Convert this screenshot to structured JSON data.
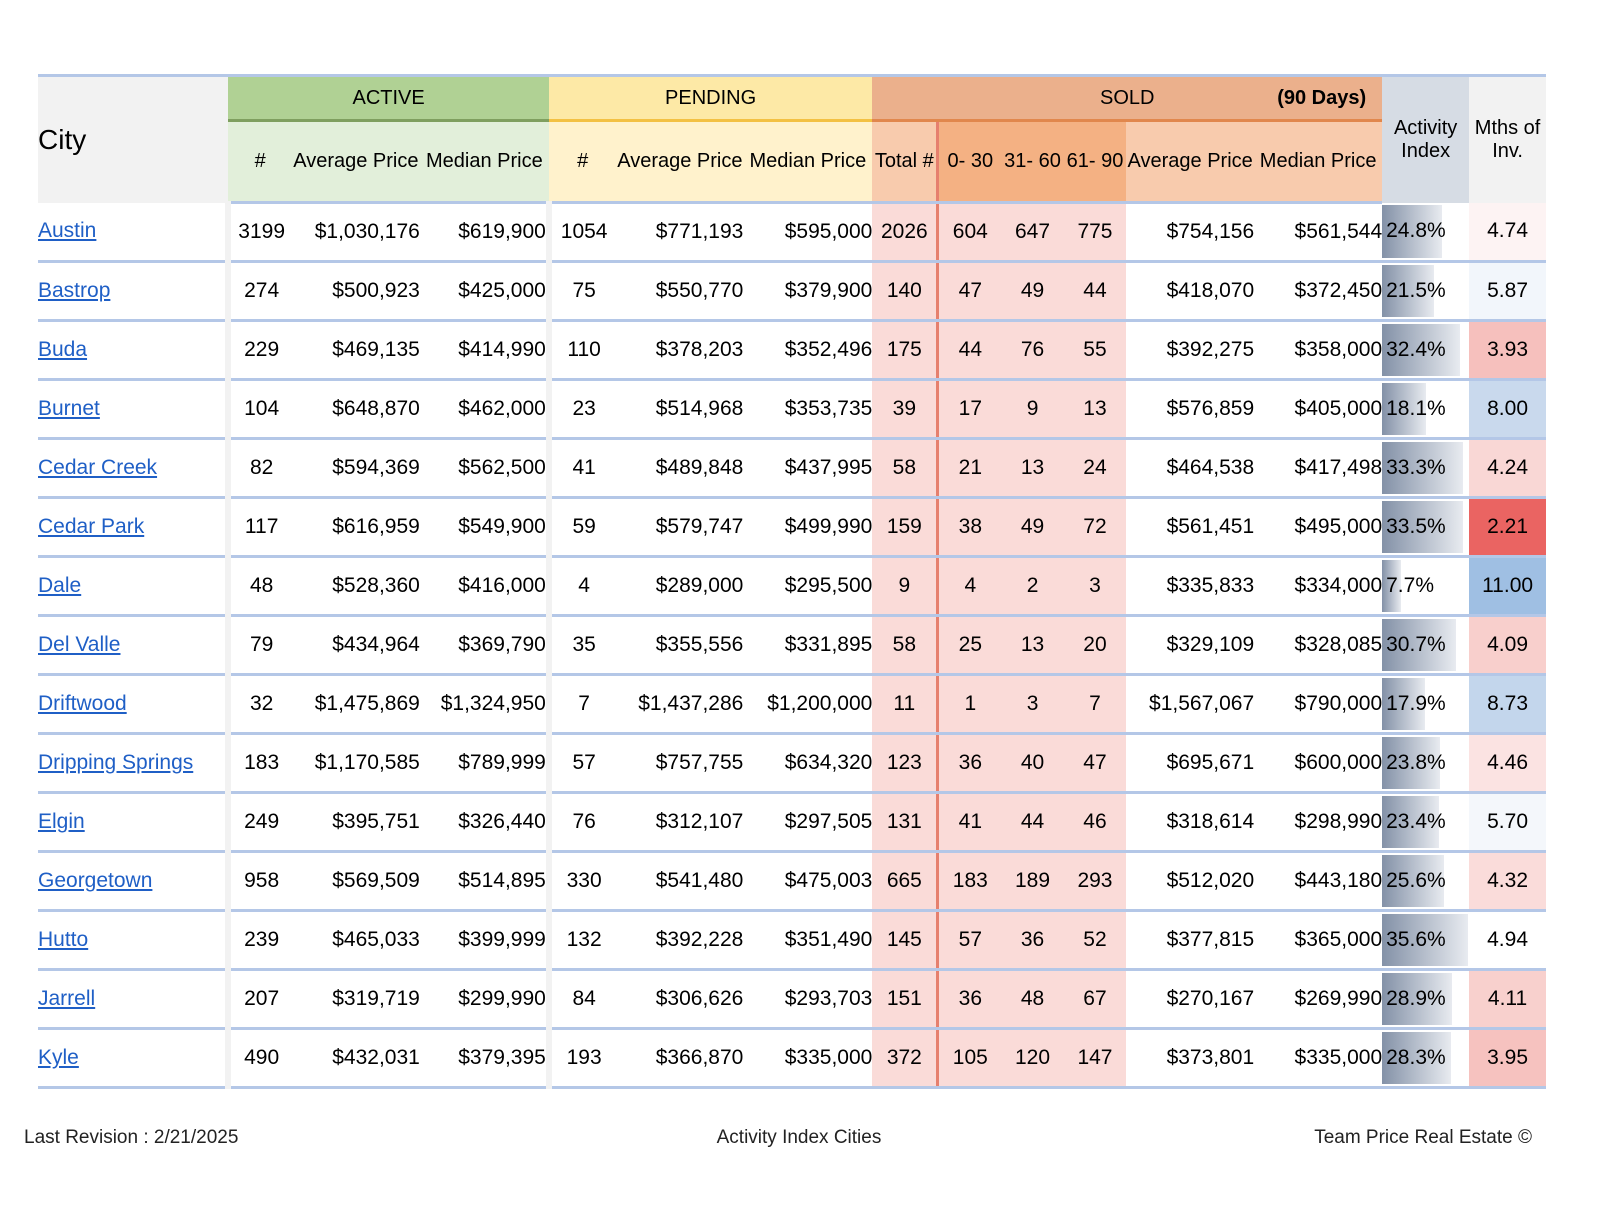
{
  "header": {
    "city": "City",
    "active": "ACTIVE",
    "pending": "PENDING",
    "sold": "SOLD",
    "sold_note": "(90 Days)",
    "activity_index": "Activity Index",
    "mths_of_inv": "Mths of Inv.",
    "count": "#",
    "avg_price": "Average Price",
    "median_price": "Median Price",
    "total": "Total #",
    "d0_30": "0- 30",
    "d31_60": "31- 60",
    "d61_90": "61- 90"
  },
  "rows": [
    {
      "city": "Austin",
      "a_n": "3199",
      "a_avg": "$1,030,176",
      "a_med": "$619,900",
      "p_n": "1054",
      "p_avg": "$771,193",
      "p_med": "$595,000",
      "s_tot": "2026",
      "s_30": "604",
      "s_60": "647",
      "s_90": "775",
      "s_avg": "$754,156",
      "s_med": "$561,544",
      "ai": "24.8%",
      "ai_level": 0.248,
      "mths": "4.74",
      "mths_color": "#fdf3f3"
    },
    {
      "city": "Bastrop",
      "a_n": "274",
      "a_avg": "$500,923",
      "a_med": "$425,000",
      "p_n": "75",
      "p_avg": "$550,770",
      "p_med": "$379,900",
      "s_tot": "140",
      "s_30": "47",
      "s_60": "49",
      "s_90": "44",
      "s_avg": "$418,070",
      "s_med": "$372,450",
      "ai": "21.5%",
      "ai_level": 0.215,
      "mths": "5.87",
      "mths_color": "#f2f6fb"
    },
    {
      "city": "Buda",
      "a_n": "229",
      "a_avg": "$469,135",
      "a_med": "$414,990",
      "p_n": "110",
      "p_avg": "$378,203",
      "p_med": "$352,496",
      "s_tot": "175",
      "s_30": "44",
      "s_60": "76",
      "s_90": "55",
      "s_avg": "$392,275",
      "s_med": "$358,000",
      "ai": "32.4%",
      "ai_level": 0.324,
      "mths": "3.93",
      "mths_color": "#f6c0bd"
    },
    {
      "city": "Burnet",
      "a_n": "104",
      "a_avg": "$648,870",
      "a_med": "$462,000",
      "p_n": "23",
      "p_avg": "$514,968",
      "p_med": "$353,735",
      "s_tot": "39",
      "s_30": "17",
      "s_60": "9",
      "s_90": "13",
      "s_avg": "$576,859",
      "s_med": "$405,000",
      "ai": "18.1%",
      "ai_level": 0.181,
      "mths": "8.00",
      "mths_color": "#c9d9ed"
    },
    {
      "city": "Cedar Creek",
      "a_n": "82",
      "a_avg": "$594,369",
      "a_med": "$562,500",
      "p_n": "41",
      "p_avg": "$489,848",
      "p_med": "$437,995",
      "s_tot": "58",
      "s_30": "21",
      "s_60": "13",
      "s_90": "24",
      "s_avg": "$464,538",
      "s_med": "$417,498",
      "ai": "33.3%",
      "ai_level": 0.333,
      "mths": "4.24",
      "mths_color": "#f9d7d5"
    },
    {
      "city": "Cedar Park",
      "a_n": "117",
      "a_avg": "$616,959",
      "a_med": "$549,900",
      "p_n": "59",
      "p_avg": "$579,747",
      "p_med": "$499,990",
      "s_tot": "159",
      "s_30": "38",
      "s_60": "49",
      "s_90": "72",
      "s_avg": "$561,451",
      "s_med": "$495,000",
      "ai": "33.5%",
      "ai_level": 0.335,
      "mths": "2.21",
      "mths_color": "#ea6462"
    },
    {
      "city": "Dale",
      "a_n": "48",
      "a_avg": "$528,360",
      "a_med": "$416,000",
      "p_n": "4",
      "p_avg": "$289,000",
      "p_med": "$295,500",
      "s_tot": "9",
      "s_30": "4",
      "s_60": "2",
      "s_90": "3",
      "s_avg": "$335,833",
      "s_med": "$334,000",
      "ai": "7.7%",
      "ai_level": 0.077,
      "mths": "11.00",
      "mths_color": "#9fbfe3"
    },
    {
      "city": "Del Valle",
      "a_n": "79",
      "a_avg": "$434,964",
      "a_med": "$369,790",
      "p_n": "35",
      "p_avg": "$355,556",
      "p_med": "$331,895",
      "s_tot": "58",
      "s_30": "25",
      "s_60": "13",
      "s_90": "20",
      "s_avg": "$329,109",
      "s_med": "$328,085",
      "ai": "30.7%",
      "ai_level": 0.307,
      "mths": "4.09",
      "mths_color": "#f8cfcc"
    },
    {
      "city": "Driftwood",
      "a_n": "32",
      "a_avg": "$1,475,869",
      "a_med": "$1,324,950",
      "p_n": "7",
      "p_avg": "$1,437,286",
      "p_med": "$1,200,000",
      "s_tot": "11",
      "s_30": "1",
      "s_60": "3",
      "s_90": "7",
      "s_avg": "$1,567,067",
      "s_med": "$790,000",
      "ai": "17.9%",
      "ai_level": 0.179,
      "mths": "8.73",
      "mths_color": "#c3d6ec"
    },
    {
      "city": "Dripping Springs",
      "a_n": "183",
      "a_avg": "$1,170,585",
      "a_med": "$789,999",
      "p_n": "57",
      "p_avg": "$757,755",
      "p_med": "$634,320",
      "s_tot": "123",
      "s_30": "36",
      "s_60": "40",
      "s_90": "47",
      "s_avg": "$695,671",
      "s_med": "$600,000",
      "ai": "23.8%",
      "ai_level": 0.238,
      "mths": "4.46",
      "mths_color": "#fbe3e2"
    },
    {
      "city": "Elgin",
      "a_n": "249",
      "a_avg": "$395,751",
      "a_med": "$326,440",
      "p_n": "76",
      "p_avg": "$312,107",
      "p_med": "$297,505",
      "s_tot": "131",
      "s_30": "41",
      "s_60": "44",
      "s_90": "46",
      "s_avg": "$318,614",
      "s_med": "$298,990",
      "ai": "23.4%",
      "ai_level": 0.234,
      "mths": "5.70",
      "mths_color": "#f4f7fb"
    },
    {
      "city": "Georgetown",
      "a_n": "958",
      "a_avg": "$569,509",
      "a_med": "$514,895",
      "p_n": "330",
      "p_avg": "$541,480",
      "p_med": "$475,003",
      "s_tot": "665",
      "s_30": "183",
      "s_60": "189",
      "s_90": "293",
      "s_avg": "$512,020",
      "s_med": "$443,180",
      "ai": "25.6%",
      "ai_level": 0.256,
      "mths": "4.32",
      "mths_color": "#fadcda"
    },
    {
      "city": "Hutto",
      "a_n": "239",
      "a_avg": "$465,033",
      "a_med": "$399,999",
      "p_n": "132",
      "p_avg": "$392,228",
      "p_med": "$351,490",
      "s_tot": "145",
      "s_30": "57",
      "s_60": "36",
      "s_90": "52",
      "s_avg": "$377,815",
      "s_med": "$365,000",
      "ai": "35.6%",
      "ai_level": 0.356,
      "mths": "4.94",
      "mths_color": "#ffffff"
    },
    {
      "city": "Jarrell",
      "a_n": "207",
      "a_avg": "$319,719",
      "a_med": "$299,990",
      "p_n": "84",
      "p_avg": "$306,626",
      "p_med": "$293,703",
      "s_tot": "151",
      "s_30": "36",
      "s_60": "48",
      "s_90": "67",
      "s_avg": "$270,167",
      "s_med": "$269,990",
      "ai": "28.9%",
      "ai_level": 0.289,
      "mths": "4.11",
      "mths_color": "#f8d0cd"
    },
    {
      "city": "Kyle",
      "a_n": "490",
      "a_avg": "$432,031",
      "a_med": "$379,395",
      "p_n": "193",
      "p_avg": "$366,870",
      "p_med": "$335,000",
      "s_tot": "372",
      "s_30": "105",
      "s_60": "120",
      "s_90": "147",
      "s_avg": "$373,801",
      "s_med": "$335,000",
      "ai": "28.3%",
      "ai_level": 0.283,
      "mths": "3.95",
      "mths_color": "#f6c2bf"
    }
  ],
  "footer": {
    "left": "Last Revision : 2/21/2025",
    "center": "Activity Index Cities",
    "right": "Team Price Real Estate ©"
  }
}
